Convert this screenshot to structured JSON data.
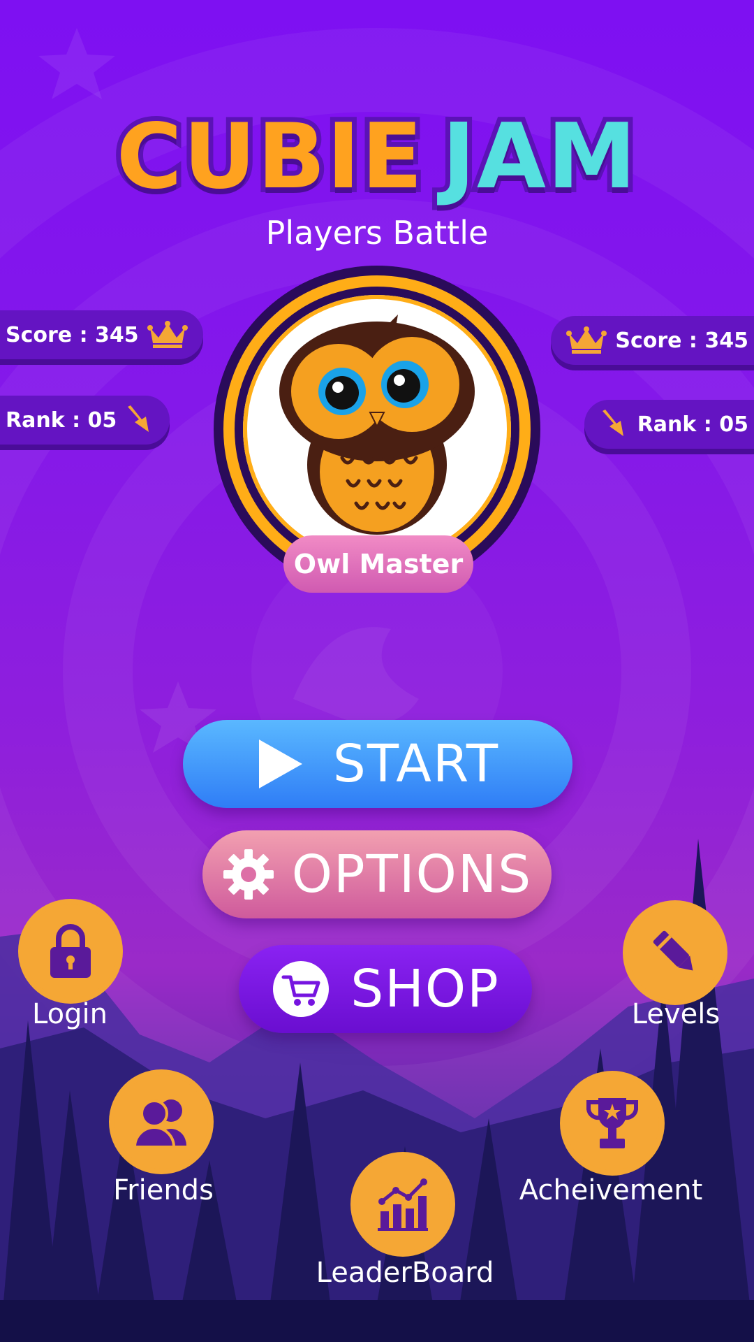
{
  "game": {
    "title_word1": "CUBIE",
    "title_word2": "JAM",
    "subtitle": "Players Battle"
  },
  "left_stats": {
    "score": "Score : 345",
    "rank": "Rank : 05"
  },
  "right_stats": {
    "score": "Score : 345",
    "rank": "Rank : 05"
  },
  "player": {
    "name": "Owl Master",
    "avatar_icon": "owl-icon"
  },
  "buttons": {
    "start": "START",
    "options": "OPTIONS",
    "shop": "SHOP"
  },
  "nav": {
    "login": "Login",
    "levels": "Levels",
    "friends": "Friends",
    "achievement": "Acheivement",
    "leaderboard": "LeaderBoard"
  },
  "colors": {
    "accent_orange": "#f5a735",
    "icon_purple": "#5a1a9a",
    "start_blue": "#3b8cf8",
    "options_pink": "#e07aa8",
    "shop_purple": "#7614e0"
  }
}
